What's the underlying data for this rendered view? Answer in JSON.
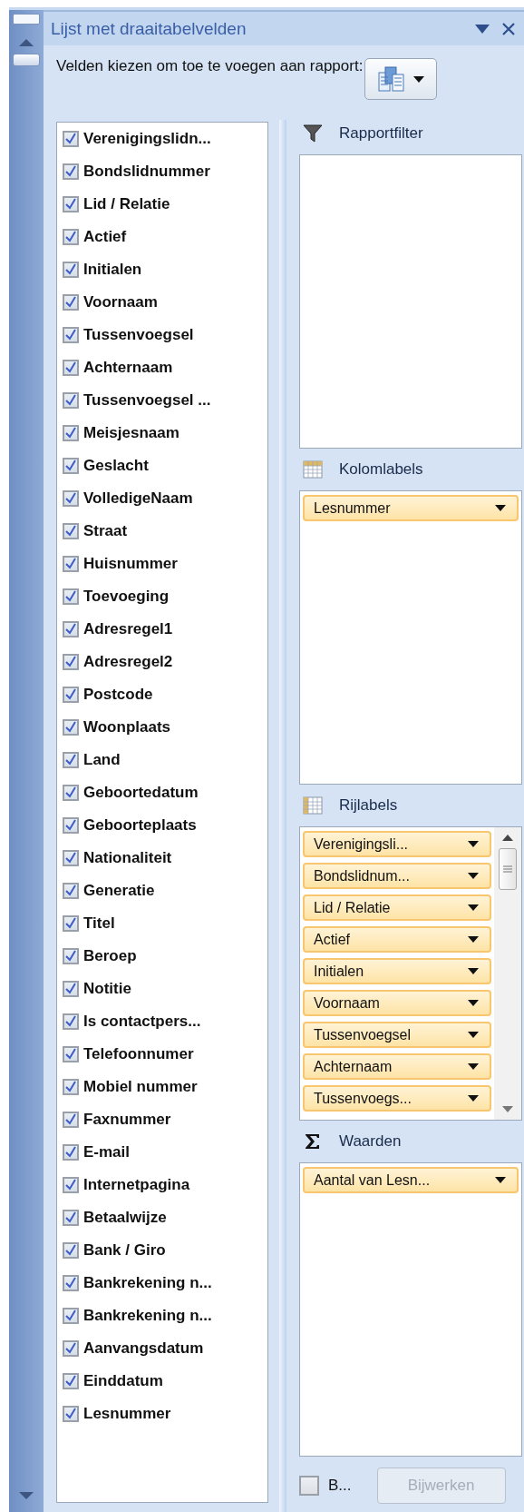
{
  "panel": {
    "title": "Lijst met draaitabelvelden",
    "instruction": "Velden kiezen om toe te voegen aan rapport:"
  },
  "fields": [
    {
      "label": "Verenigingslidn...",
      "checked": true
    },
    {
      "label": "Bondslidnummer",
      "checked": true
    },
    {
      "label": "Lid / Relatie",
      "checked": true
    },
    {
      "label": "Actief",
      "checked": true
    },
    {
      "label": "Initialen",
      "checked": true
    },
    {
      "label": "Voornaam",
      "checked": true
    },
    {
      "label": "Tussenvoegsel",
      "checked": true
    },
    {
      "label": "Achternaam",
      "checked": true
    },
    {
      "label": "Tussenvoegsel ...",
      "checked": true
    },
    {
      "label": "Meisjesnaam",
      "checked": true
    },
    {
      "label": "Geslacht",
      "checked": true
    },
    {
      "label": "VolledigeNaam",
      "checked": true
    },
    {
      "label": "Straat",
      "checked": true
    },
    {
      "label": "Huisnummer",
      "checked": true
    },
    {
      "label": "Toevoeging",
      "checked": true
    },
    {
      "label": "Adresregel1",
      "checked": true
    },
    {
      "label": "Adresregel2",
      "checked": true
    },
    {
      "label": "Postcode",
      "checked": true
    },
    {
      "label": "Woonplaats",
      "checked": true
    },
    {
      "label": "Land",
      "checked": true
    },
    {
      "label": "Geboortedatum",
      "checked": true
    },
    {
      "label": "Geboorteplaats",
      "checked": true
    },
    {
      "label": "Nationaliteit",
      "checked": true
    },
    {
      "label": "Generatie",
      "checked": true
    },
    {
      "label": "Titel",
      "checked": true
    },
    {
      "label": "Beroep",
      "checked": true
    },
    {
      "label": "Notitie",
      "checked": true
    },
    {
      "label": "Is contactpers...",
      "checked": true
    },
    {
      "label": "Telefoonnumer",
      "checked": true
    },
    {
      "label": "Mobiel nummer",
      "checked": true
    },
    {
      "label": "Faxnummer",
      "checked": true
    },
    {
      "label": "E-mail",
      "checked": true
    },
    {
      "label": "Internetpagina",
      "checked": true
    },
    {
      "label": "Betaalwijze",
      "checked": true
    },
    {
      "label": "Bank / Giro",
      "checked": true
    },
    {
      "label": "Bankrekening n...",
      "checked": true
    },
    {
      "label": "Bankrekening n...",
      "checked": true
    },
    {
      "label": "Aanvangsdatum",
      "checked": true
    },
    {
      "label": "Einddatum",
      "checked": true
    },
    {
      "label": "Lesnummer",
      "checked": true
    }
  ],
  "areas": [
    {
      "kind": "filter",
      "title": "Rapportfilter"
    },
    {
      "kind": "columns",
      "title": "Kolomlabels",
      "items": [
        "Lesnummer"
      ]
    },
    {
      "kind": "rows",
      "title": "Rijlabels",
      "scrollable": true,
      "items": [
        "Verenigingsli...",
        "Bondslidnum...",
        "Lid / Relatie",
        "Actief",
        "Initialen",
        "Voornaam",
        "Tussenvoegsel",
        "Achternaam",
        "Tussenvoegs..."
      ]
    },
    {
      "kind": "values",
      "title": "Waarden",
      "items": [
        "Aantal van Lesn..."
      ]
    }
  ],
  "defer_update": {
    "label": "B...",
    "checked": false
  },
  "update_button": {
    "label": "Bijwerken",
    "disabled": true
  }
}
